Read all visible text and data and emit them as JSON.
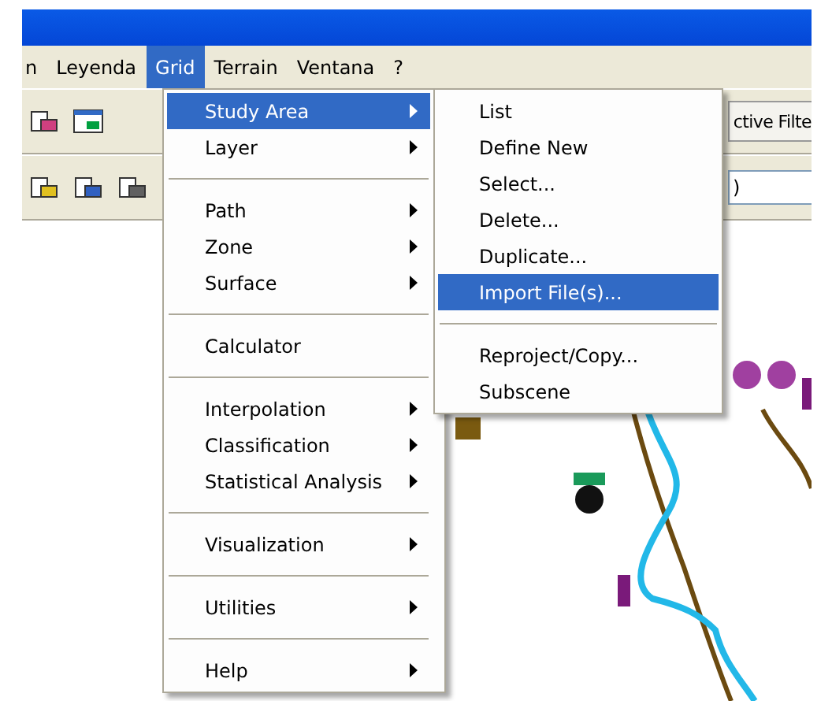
{
  "menu_bar": [
    {
      "label": "n",
      "selected": false
    },
    {
      "label": "Leyenda",
      "selected": false
    },
    {
      "label": "Grid",
      "selected": true
    },
    {
      "label": "Terrain",
      "selected": false
    },
    {
      "label": "Ventana",
      "selected": false
    },
    {
      "label": "?",
      "selected": false
    }
  ],
  "toolbar": {
    "filter_button": "ctive Filte",
    "field_value": ")"
  },
  "grid_menu": [
    {
      "kind": "item",
      "label": "Study Area",
      "submenu": true,
      "selected": true
    },
    {
      "kind": "item",
      "label": "Layer",
      "submenu": true,
      "selected": false
    },
    {
      "kind": "separator"
    },
    {
      "kind": "item",
      "label": "Path",
      "submenu": true,
      "selected": false
    },
    {
      "kind": "item",
      "label": "Zone",
      "submenu": true,
      "selected": false
    },
    {
      "kind": "item",
      "label": "Surface",
      "submenu": true,
      "selected": false
    },
    {
      "kind": "separator"
    },
    {
      "kind": "item",
      "label": "Calculator",
      "submenu": false,
      "selected": false
    },
    {
      "kind": "separator"
    },
    {
      "kind": "item",
      "label": "Interpolation",
      "submenu": true,
      "selected": false
    },
    {
      "kind": "item",
      "label": "Classification",
      "submenu": true,
      "selected": false
    },
    {
      "kind": "item",
      "label": "Statistical Analysis",
      "submenu": true,
      "selected": false
    },
    {
      "kind": "separator"
    },
    {
      "kind": "item",
      "label": "Visualization",
      "submenu": true,
      "selected": false
    },
    {
      "kind": "separator"
    },
    {
      "kind": "item",
      "label": "Utilities",
      "submenu": true,
      "selected": false
    },
    {
      "kind": "separator"
    },
    {
      "kind": "item",
      "label": "Help",
      "submenu": true,
      "selected": false
    }
  ],
  "study_area_menu": [
    {
      "kind": "item",
      "label": "List",
      "submenu": false,
      "selected": false
    },
    {
      "kind": "item",
      "label": "Define New",
      "submenu": false,
      "selected": false
    },
    {
      "kind": "item",
      "label": "Select...",
      "submenu": false,
      "selected": false
    },
    {
      "kind": "item",
      "label": "Delete...",
      "submenu": false,
      "selected": false
    },
    {
      "kind": "item",
      "label": "Duplicate...",
      "submenu": false,
      "selected": false
    },
    {
      "kind": "item",
      "label": "Import File(s)...",
      "submenu": false,
      "selected": true
    },
    {
      "kind": "separator"
    },
    {
      "kind": "item",
      "label": "Reproject/Copy...",
      "submenu": false,
      "selected": false
    },
    {
      "kind": "item",
      "label": "Subscene",
      "submenu": false,
      "selected": false
    }
  ]
}
